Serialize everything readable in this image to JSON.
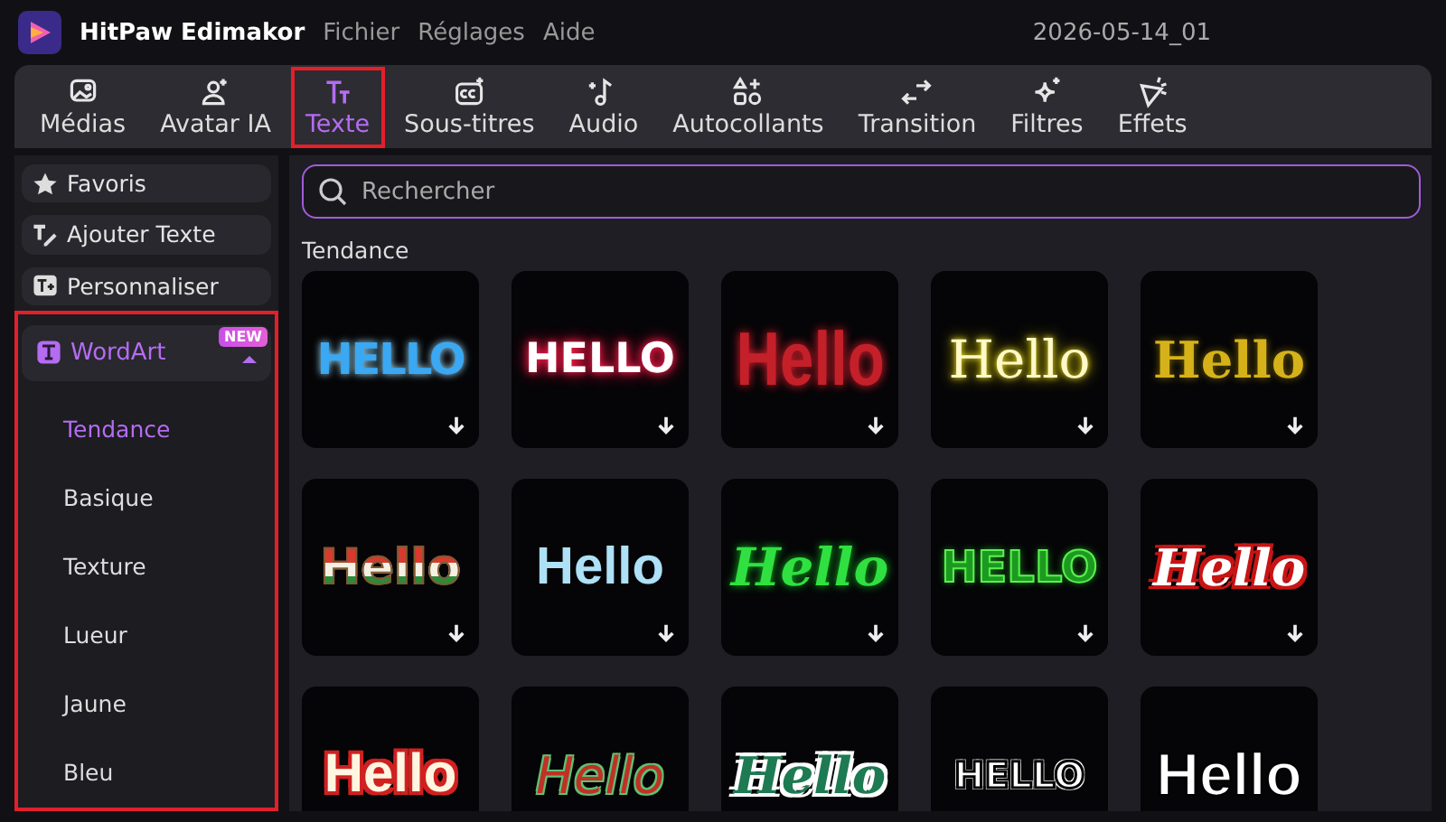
{
  "titlebar": {
    "app_name": "HitPaw Edimakor",
    "menu": [
      "Fichier",
      "Réglages",
      "Aide"
    ],
    "project": "2026-05-14_01"
  },
  "tabs": [
    {
      "label": "Médias",
      "kind": "media",
      "selected": false,
      "highlighted": false
    },
    {
      "label": "Avatar IA",
      "kind": "avatar",
      "selected": false,
      "highlighted": false
    },
    {
      "label": "Texte",
      "kind": "text",
      "selected": true,
      "highlighted": true
    },
    {
      "label": "Sous-titres",
      "kind": "cc",
      "selected": false,
      "highlighted": false
    },
    {
      "label": "Audio",
      "kind": "audio",
      "selected": false,
      "highlighted": false
    },
    {
      "label": "Autocollants",
      "kind": "sticker",
      "selected": false,
      "highlighted": false
    },
    {
      "label": "Transition",
      "kind": "transition",
      "selected": false,
      "highlighted": false
    },
    {
      "label": "Filtres",
      "kind": "filter",
      "selected": false,
      "highlighted": false
    },
    {
      "label": "Effets",
      "kind": "effect",
      "selected": false,
      "highlighted": false
    }
  ],
  "sidebar": {
    "items": [
      {
        "label": "Favoris",
        "kind": "star"
      },
      {
        "label": "Ajouter Texte",
        "kind": "add-text"
      },
      {
        "label": "Personnaliser",
        "kind": "custom"
      }
    ],
    "group": {
      "label": "WordArt",
      "badge": "NEW",
      "expanded": true,
      "highlighted": true,
      "children": [
        {
          "label": "Tendance",
          "selected": true
        },
        {
          "label": "Basique",
          "selected": false
        },
        {
          "label": "Texture",
          "selected": false
        },
        {
          "label": "Lueur",
          "selected": false
        },
        {
          "label": "Jaune",
          "selected": false
        },
        {
          "label": "Bleu",
          "selected": false
        }
      ]
    }
  },
  "search": {
    "placeholder": "Rechercher"
  },
  "section_title": "Tendance",
  "tiles": [
    {
      "text": "HELLO",
      "kind": "ice"
    },
    {
      "text": "HELLO",
      "kind": "neonred"
    },
    {
      "text": "Hello",
      "kind": "glitterred"
    },
    {
      "text": "Hello",
      "kind": "neonyellow"
    },
    {
      "text": "Hello",
      "kind": "gold"
    },
    {
      "text": "Hello",
      "kind": "striped"
    },
    {
      "text": "Hello",
      "kind": "gingham"
    },
    {
      "text": "Hello",
      "kind": "greenscript"
    },
    {
      "text": "HELLO",
      "kind": "greenblock"
    },
    {
      "text": "Hello",
      "kind": "redscript"
    },
    {
      "text": "Hello",
      "kind": "redoutline"
    },
    {
      "text": "Hello",
      "kind": "scriptoutline"
    },
    {
      "text": "Hello",
      "kind": "tealscript"
    },
    {
      "text": "HELLO",
      "kind": "whiteblock"
    },
    {
      "text": "Hello",
      "kind": "bubble"
    }
  ]
}
